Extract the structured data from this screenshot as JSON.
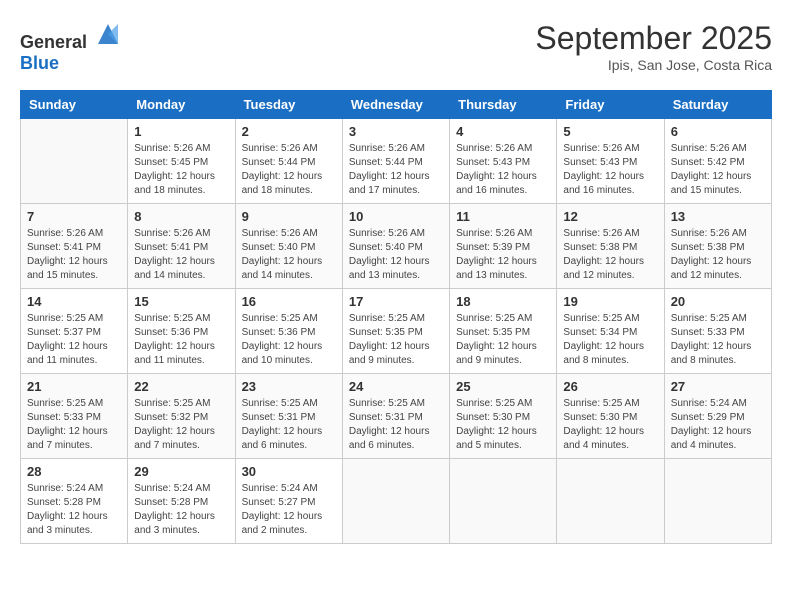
{
  "header": {
    "logo": {
      "general": "General",
      "blue": "Blue"
    },
    "title": "September 2025",
    "subtitle": "Ipis, San Jose, Costa Rica"
  },
  "days_of_week": [
    "Sunday",
    "Monday",
    "Tuesday",
    "Wednesday",
    "Thursday",
    "Friday",
    "Saturday"
  ],
  "weeks": [
    [
      {
        "day": "",
        "info": ""
      },
      {
        "day": "1",
        "info": "Sunrise: 5:26 AM\nSunset: 5:45 PM\nDaylight: 12 hours\nand 18 minutes."
      },
      {
        "day": "2",
        "info": "Sunrise: 5:26 AM\nSunset: 5:44 PM\nDaylight: 12 hours\nand 18 minutes."
      },
      {
        "day": "3",
        "info": "Sunrise: 5:26 AM\nSunset: 5:44 PM\nDaylight: 12 hours\nand 17 minutes."
      },
      {
        "day": "4",
        "info": "Sunrise: 5:26 AM\nSunset: 5:43 PM\nDaylight: 12 hours\nand 16 minutes."
      },
      {
        "day": "5",
        "info": "Sunrise: 5:26 AM\nSunset: 5:43 PM\nDaylight: 12 hours\nand 16 minutes."
      },
      {
        "day": "6",
        "info": "Sunrise: 5:26 AM\nSunset: 5:42 PM\nDaylight: 12 hours\nand 15 minutes."
      }
    ],
    [
      {
        "day": "7",
        "info": "Sunrise: 5:26 AM\nSunset: 5:41 PM\nDaylight: 12 hours\nand 15 minutes."
      },
      {
        "day": "8",
        "info": "Sunrise: 5:26 AM\nSunset: 5:41 PM\nDaylight: 12 hours\nand 14 minutes."
      },
      {
        "day": "9",
        "info": "Sunrise: 5:26 AM\nSunset: 5:40 PM\nDaylight: 12 hours\nand 14 minutes."
      },
      {
        "day": "10",
        "info": "Sunrise: 5:26 AM\nSunset: 5:40 PM\nDaylight: 12 hours\nand 13 minutes."
      },
      {
        "day": "11",
        "info": "Sunrise: 5:26 AM\nSunset: 5:39 PM\nDaylight: 12 hours\nand 13 minutes."
      },
      {
        "day": "12",
        "info": "Sunrise: 5:26 AM\nSunset: 5:38 PM\nDaylight: 12 hours\nand 12 minutes."
      },
      {
        "day": "13",
        "info": "Sunrise: 5:26 AM\nSunset: 5:38 PM\nDaylight: 12 hours\nand 12 minutes."
      }
    ],
    [
      {
        "day": "14",
        "info": "Sunrise: 5:25 AM\nSunset: 5:37 PM\nDaylight: 12 hours\nand 11 minutes."
      },
      {
        "day": "15",
        "info": "Sunrise: 5:25 AM\nSunset: 5:36 PM\nDaylight: 12 hours\nand 11 minutes."
      },
      {
        "day": "16",
        "info": "Sunrise: 5:25 AM\nSunset: 5:36 PM\nDaylight: 12 hours\nand 10 minutes."
      },
      {
        "day": "17",
        "info": "Sunrise: 5:25 AM\nSunset: 5:35 PM\nDaylight: 12 hours\nand 9 minutes."
      },
      {
        "day": "18",
        "info": "Sunrise: 5:25 AM\nSunset: 5:35 PM\nDaylight: 12 hours\nand 9 minutes."
      },
      {
        "day": "19",
        "info": "Sunrise: 5:25 AM\nSunset: 5:34 PM\nDaylight: 12 hours\nand 8 minutes."
      },
      {
        "day": "20",
        "info": "Sunrise: 5:25 AM\nSunset: 5:33 PM\nDaylight: 12 hours\nand 8 minutes."
      }
    ],
    [
      {
        "day": "21",
        "info": "Sunrise: 5:25 AM\nSunset: 5:33 PM\nDaylight: 12 hours\nand 7 minutes."
      },
      {
        "day": "22",
        "info": "Sunrise: 5:25 AM\nSunset: 5:32 PM\nDaylight: 12 hours\nand 7 minutes."
      },
      {
        "day": "23",
        "info": "Sunrise: 5:25 AM\nSunset: 5:31 PM\nDaylight: 12 hours\nand 6 minutes."
      },
      {
        "day": "24",
        "info": "Sunrise: 5:25 AM\nSunset: 5:31 PM\nDaylight: 12 hours\nand 6 minutes."
      },
      {
        "day": "25",
        "info": "Sunrise: 5:25 AM\nSunset: 5:30 PM\nDaylight: 12 hours\nand 5 minutes."
      },
      {
        "day": "26",
        "info": "Sunrise: 5:25 AM\nSunset: 5:30 PM\nDaylight: 12 hours\nand 4 minutes."
      },
      {
        "day": "27",
        "info": "Sunrise: 5:24 AM\nSunset: 5:29 PM\nDaylight: 12 hours\nand 4 minutes."
      }
    ],
    [
      {
        "day": "28",
        "info": "Sunrise: 5:24 AM\nSunset: 5:28 PM\nDaylight: 12 hours\nand 3 minutes."
      },
      {
        "day": "29",
        "info": "Sunrise: 5:24 AM\nSunset: 5:28 PM\nDaylight: 12 hours\nand 3 minutes."
      },
      {
        "day": "30",
        "info": "Sunrise: 5:24 AM\nSunset: 5:27 PM\nDaylight: 12 hours\nand 2 minutes."
      },
      {
        "day": "",
        "info": ""
      },
      {
        "day": "",
        "info": ""
      },
      {
        "day": "",
        "info": ""
      },
      {
        "day": "",
        "info": ""
      }
    ]
  ]
}
